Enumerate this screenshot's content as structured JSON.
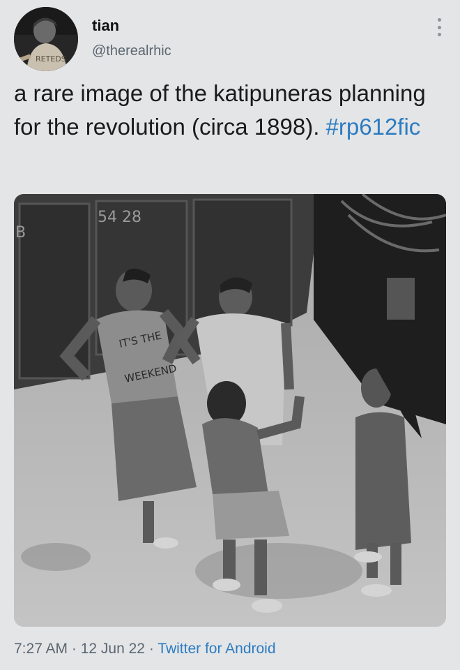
{
  "author": {
    "display_name": "tian",
    "handle": "@therealrhic"
  },
  "avatar": {
    "shirt_text": "RETEDS"
  },
  "more_icon": "more-vertical-icon",
  "tweet": {
    "text": "a rare image of the katipuneras planning for the revolution (circa 1898). ",
    "hashtag": "#rp612fic"
  },
  "photo": {
    "gate_number": "54 28",
    "gate_side_letter": "B",
    "shirt_line1": "IT'S THE",
    "shirt_line2": "WEEKEND"
  },
  "meta": {
    "time": "7:27 AM",
    "separator": " · ",
    "date": "12 Jun 22",
    "source": "Twitter for Android"
  }
}
